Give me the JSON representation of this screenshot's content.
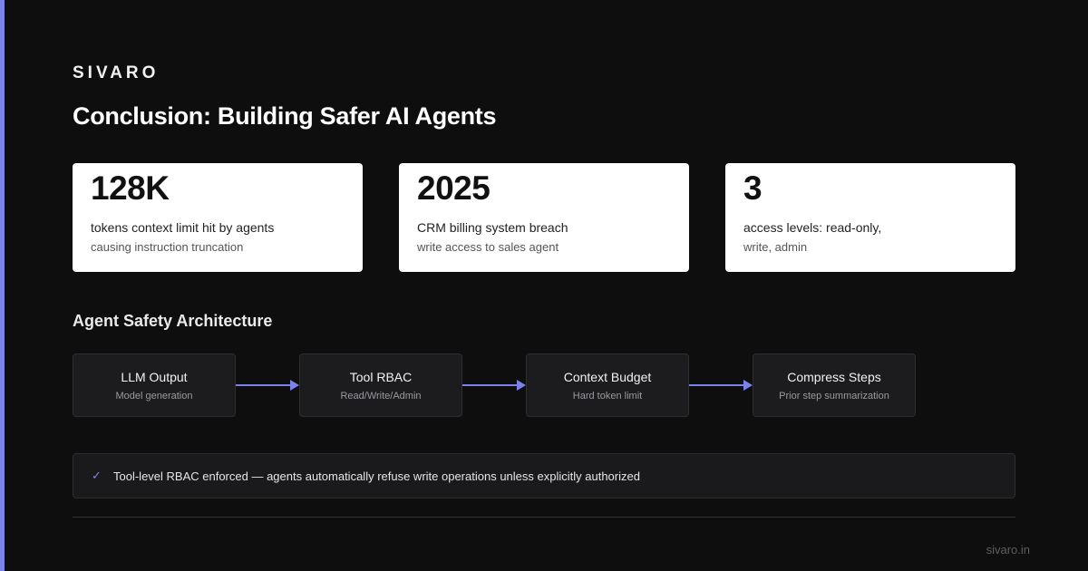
{
  "brand": "SIVARO",
  "title": "Conclusion: Building Safer AI Agents",
  "stats": [
    {
      "value": "128K",
      "label": "tokens context limit hit by agents",
      "sub": "causing instruction truncation"
    },
    {
      "value": "2025",
      "label": "CRM billing system breach",
      "sub": "write access to sales agent"
    },
    {
      "value": "3",
      "label": "access levels: read-only,",
      "sub": "write, admin"
    }
  ],
  "section_title": "Agent Safety Architecture",
  "flow": [
    {
      "title": "LLM Output",
      "sub": "Model generation"
    },
    {
      "title": "Tool RBAC",
      "sub": "Read/Write/Admin"
    },
    {
      "title": "Context Budget",
      "sub": "Hard token limit"
    },
    {
      "title": "Compress Steps",
      "sub": "Prior step summarization"
    }
  ],
  "callout": {
    "icon": "check-icon",
    "text": "Tool-level RBAC enforced — agents automatically refuse write operations unless explicitly authorized"
  },
  "footer": "sivaro.in",
  "colors": {
    "accent": "#7b83eb",
    "background": "#0e0e0f",
    "card": "#ffffff"
  }
}
